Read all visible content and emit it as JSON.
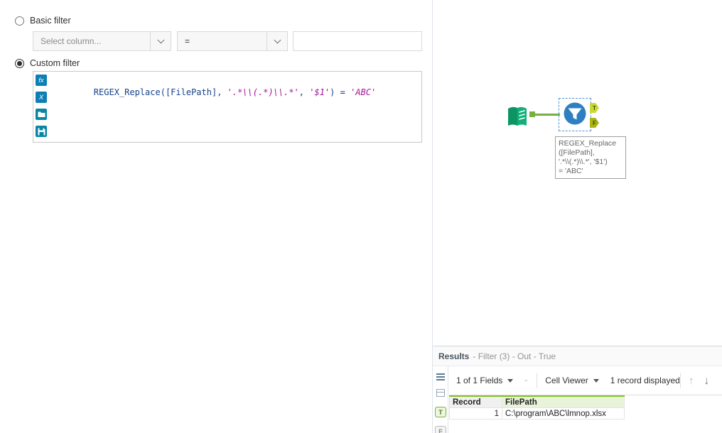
{
  "config": {
    "basic_filter_label": "Basic filter",
    "custom_filter_label": "Custom filter",
    "column_dropdown": {
      "placeholder": "Select column..."
    },
    "operator_dropdown": {
      "value": "="
    },
    "value_input": {
      "value": ""
    },
    "expression_editor": {
      "segments": [
        {
          "kind": "code",
          "text": "REGEX_Replace([FilePath], "
        },
        {
          "kind": "string",
          "text": "'.*\\\\(.*)\\\\.*'"
        },
        {
          "kind": "code",
          "text": ", "
        },
        {
          "kind": "string",
          "text": "'$1'"
        },
        {
          "kind": "code",
          "text": ") = "
        },
        {
          "kind": "string",
          "text": "'ABC'"
        }
      ],
      "icons": [
        {
          "name": "fx-icon",
          "glyph": "fx"
        },
        {
          "name": "variables-icon",
          "glyph": "X"
        },
        {
          "name": "open-expression-icon"
        },
        {
          "name": "save-expression-icon"
        }
      ]
    }
  },
  "canvas": {
    "filter_tool": {
      "true_anchor": "T",
      "false_anchor": "F",
      "annotation_lines": [
        "REGEX_Replace",
        "([FilePath],",
        "'.*\\\\(.*)\\\\.*', '$1')",
        "= 'ABC'"
      ]
    }
  },
  "results": {
    "title": "Results",
    "subtitle": "- Filter (3) - Out - True",
    "toolbar": {
      "fields_summary": "1 of 1 Fields",
      "cell_viewer_label": "Cell Viewer",
      "record_count": "1 record displayed"
    },
    "anchors": {
      "true": "T",
      "false": "F"
    },
    "table": {
      "columns": [
        "Record",
        "FilePath"
      ],
      "rows": [
        {
          "record": "1",
          "filepath": "C:\\program\\ABC\\lmnop.xlsx"
        }
      ]
    }
  },
  "colors": {
    "accent_blue": "#2e7fc1",
    "tool_green": "#0d9463",
    "wire_green": "#76b043",
    "anchor_true": "#c9d934",
    "anchor_false": "#a9b417",
    "expr_code": "#15428b",
    "expr_string": "#a31597",
    "table_accent_green": "#84c225"
  }
}
